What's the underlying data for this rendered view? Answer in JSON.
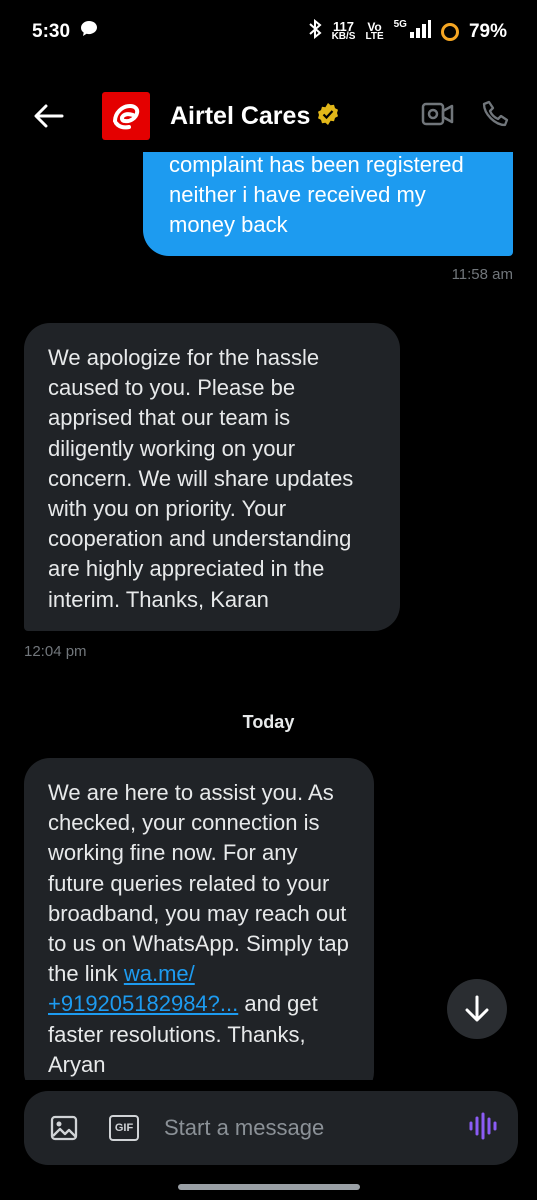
{
  "status_bar": {
    "time": "5:30",
    "speed_value": "117",
    "speed_unit": "KB/S",
    "volte_top": "Vo",
    "volte_bottom": "LTE",
    "network": "5G",
    "battery": "79%"
  },
  "header": {
    "title": "Airtel Cares",
    "icons": [
      "back-arrow-icon",
      "airtel-logo",
      "verified-badge-icon",
      "video-call-icon",
      "phone-call-icon"
    ]
  },
  "messages": {
    "outgoing_1": {
      "text": "complaint has been registered neither i have received my money back",
      "time": "11:58 am"
    },
    "incoming_1": {
      "text": "We apologize for the hassle caused to you. Please be apprised that our team is diligently working on your concern. We will share updates with you on priority. Your cooperation and understanding are highly appreciated in the interim. Thanks, Karan",
      "time": "12:04 pm"
    },
    "day_divider": "Today",
    "incoming_2": {
      "text_before": "We are here to assist you. As checked, your connection is working fine now. For any future queries related to your broadband, you may reach out to us on WhatsApp. Simply tap the link ",
      "link": "wa.me/ +919205182984?...",
      "text_after": " and get faster resolutions. Thanks, Aryan"
    }
  },
  "composer": {
    "placeholder": "Start a message",
    "gif_label": "GIF"
  },
  "colors": {
    "accent": "#1d9bf0",
    "incoming_bubble": "#202327",
    "background": "#000000",
    "airtel_red": "#e40000",
    "verified_gold": "#e2b719"
  }
}
